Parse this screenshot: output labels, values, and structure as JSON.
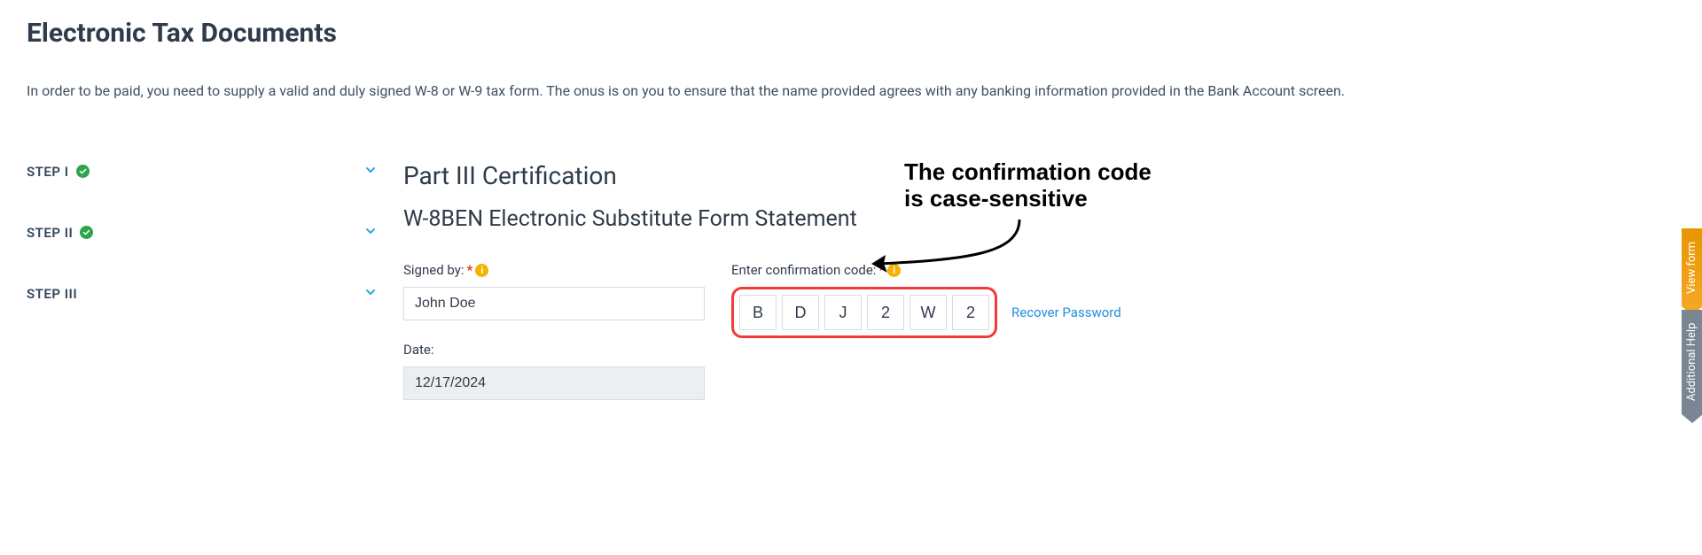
{
  "page": {
    "title": "Electronic Tax Documents",
    "intro": "In order to be paid, you need to supply a valid and duly signed W-8 or W-9 tax form. The onus is on you to ensure that the name provided agrees with any banking information provided in the Bank Account screen."
  },
  "steps": [
    {
      "label": "STEP I",
      "complete": true
    },
    {
      "label": "STEP II",
      "complete": true
    },
    {
      "label": "STEP III",
      "complete": false
    }
  ],
  "content": {
    "cert_title": "Part III Certification",
    "form_statement": "W-8BEN Electronic Substitute Form Statement",
    "signed_by_label": "Signed by:",
    "signed_by_value": "John Doe",
    "date_label": "Date:",
    "date_value": "12/17/2024",
    "code_label": "Enter confirmation code:",
    "code_values": [
      "B",
      "D",
      "J",
      "2",
      "W",
      "2"
    ],
    "recover_link": "Recover Password"
  },
  "annotation": {
    "line1": "The confirmation code",
    "line2": "is case-sensitive"
  },
  "side_tabs": {
    "view_form": "View form",
    "additional_help": "Additional Help"
  },
  "colors": {
    "accent_green": "#2EA44F",
    "accent_blue": "#1F90D8",
    "warn_yellow": "#F1B400",
    "highlight_red": "#F23A3A",
    "tab_orange": "#F5A623",
    "tab_gray": "#7A8691"
  }
}
